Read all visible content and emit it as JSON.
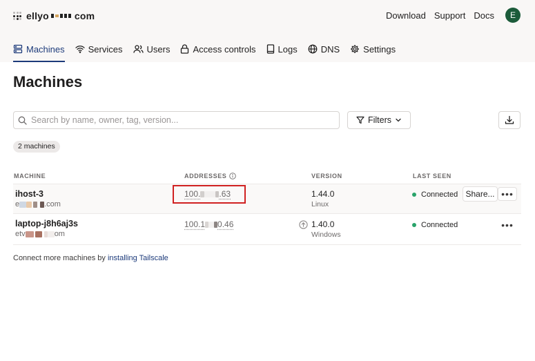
{
  "brand": {
    "name_prefix": "ellyo",
    "name_suffix": "com"
  },
  "top_links": {
    "download": "Download",
    "support": "Support",
    "docs": "Docs",
    "avatar_initial": "E"
  },
  "nav": {
    "machines": "Machines",
    "services": "Services",
    "users": "Users",
    "access_controls": "Access controls",
    "logs": "Logs",
    "dns": "DNS",
    "settings": "Settings",
    "active": "machines"
  },
  "page": {
    "title": "Machines"
  },
  "search": {
    "placeholder": "Search by name, owner, tag, version..."
  },
  "filters": {
    "label": "Filters"
  },
  "badge": {
    "count_label": "2 machines"
  },
  "table": {
    "headers": {
      "machine": "MACHINE",
      "addresses": "ADDRESSES",
      "version": "VERSION",
      "last_seen": "LAST SEEN"
    },
    "rows": [
      {
        "name": "ihost-3",
        "owner_start": "e",
        "owner_end": ".com",
        "address_start": "100.",
        "address_end": ".63",
        "version": "1.44.0",
        "os": "Linux",
        "last_seen": "Connected"
      },
      {
        "name": "laptop-j8h6aj3s",
        "owner_start": "etv",
        "owner_end": "om",
        "address_start": "100.1",
        "address_end": "0.46",
        "version": "1.40.0",
        "os": "Windows",
        "last_seen": "Connected"
      }
    ]
  },
  "row_actions": {
    "share": "Share...",
    "more": "•••"
  },
  "footer": {
    "prefix": "Connect more machines by ",
    "link": "installing Tailscale"
  },
  "colors": {
    "accent": "#1c3a7a",
    "status_connected": "#29a36a",
    "highlight": "#d02020",
    "avatar": "#1c5b3a"
  }
}
